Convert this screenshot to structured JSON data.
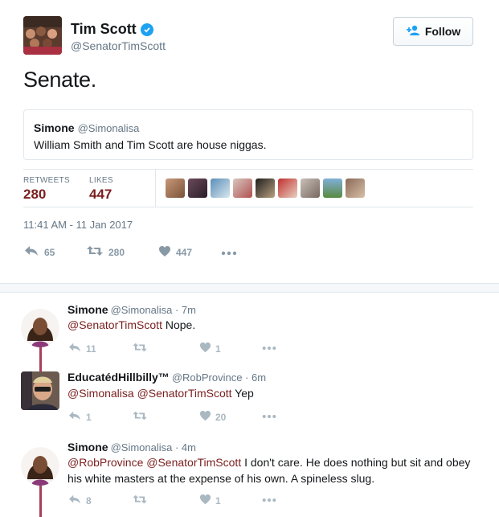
{
  "main_tweet": {
    "author": {
      "name": "Tim Scott",
      "handle": "@SenatorTimScott",
      "verified": true
    },
    "follow_label": "Follow",
    "text": "Senate.",
    "quote": {
      "name": "Simone",
      "handle": "@Simonalisa",
      "text": "William Smith and Tim Scott are house niggas."
    },
    "stats": {
      "retweets_label": "RETWEETS",
      "retweets": "280",
      "likes_label": "LIKES",
      "likes": "447"
    },
    "timestamp": "11:41 AM - 11 Jan 2017",
    "actions": {
      "replies": "65",
      "retweets": "280",
      "likes": "447"
    }
  },
  "replies": [
    {
      "name": "Simone",
      "meta": "@Simonalisa · 7m",
      "mentions": "@SenatorTimScott",
      "text": " Nope.",
      "actions": {
        "replies": "11",
        "retweets": "",
        "likes": "1"
      }
    },
    {
      "name": "EducatédHillbilly™",
      "meta": "@RobProvince · 6m",
      "mentions": "@Simonalisa @SenatorTimScott",
      "text": " Yep",
      "actions": {
        "replies": "1",
        "retweets": "",
        "likes": "20"
      }
    },
    {
      "name": "Simone",
      "meta": "@Simonalisa · 4m",
      "mentions": "@RobProvince @SenatorTimScott",
      "text": " I don't care. He does nothing but sit and obey his white masters at the expense of his own. A spineless slug.",
      "actions": {
        "replies": "8",
        "retweets": "",
        "likes": "1"
      }
    }
  ],
  "colors": {
    "accent_link": "#7b1e1e",
    "verified": "#1da1f2",
    "thread_line": "#a7405a",
    "muted": "#657786"
  }
}
